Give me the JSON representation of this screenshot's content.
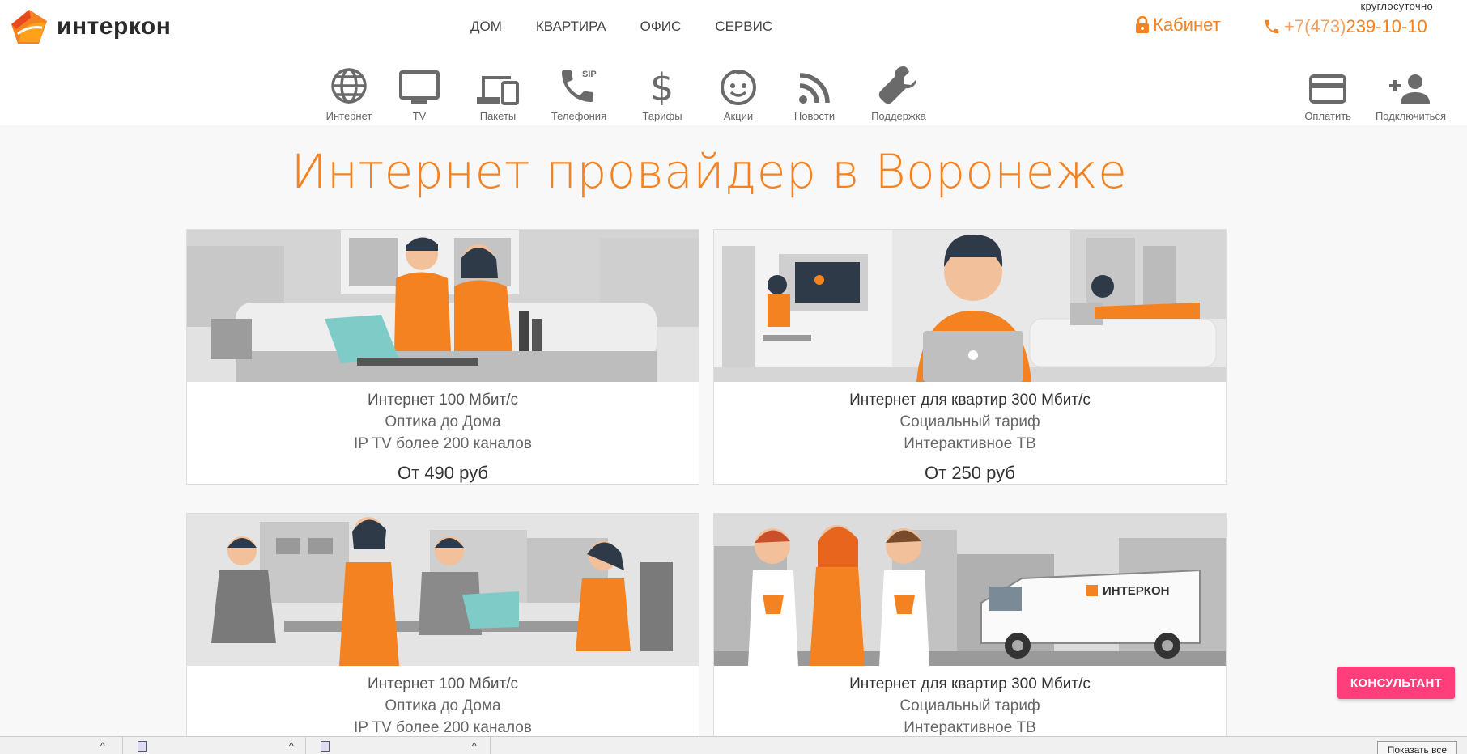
{
  "brand": {
    "name": "интеркон"
  },
  "topnav": [
    {
      "label": "ДОМ"
    },
    {
      "label": "КВАРТИРА"
    },
    {
      "label": "ОФИС"
    },
    {
      "label": "СЕРВИС"
    }
  ],
  "cabinet": {
    "label": "Кабинет"
  },
  "contact": {
    "note": "круглосуточно",
    "phone_code": "+7(473)",
    "phone_number": " 239-10-10"
  },
  "iconnav": [
    {
      "label": "Интернет",
      "icon": "globe-icon"
    },
    {
      "label": "TV",
      "icon": "tv-icon"
    },
    {
      "label": "Пакеты",
      "icon": "devices-icon"
    },
    {
      "label": "Телефония",
      "icon": "sip-phone-icon"
    },
    {
      "label": "Тарифы",
      "icon": "dollar-icon"
    },
    {
      "label": "Акции",
      "icon": "smiley-icon"
    },
    {
      "label": "Новости",
      "icon": "rss-icon"
    },
    {
      "label": "Поддержка",
      "icon": "wrench-icon"
    }
  ],
  "rightnav": [
    {
      "label": "Оплатить",
      "icon": "credit-card-icon"
    },
    {
      "label": "Подключиться",
      "icon": "add-user-icon"
    }
  ],
  "main": {
    "title": "Интернет провайдер в Воронеже",
    "cards": [
      {
        "lines": [
          "Интернет 100 Мбит/с",
          "Оптика до Дома",
          "IP TV более 200 каналов"
        ],
        "price": "От 490 руб"
      },
      {
        "lines": [
          "Интернет для квартир 300 Мбит/с",
          "Социальный тариф",
          "Интерактивное ТВ"
        ],
        "price": "От 250 руб"
      },
      {
        "lines": [
          "Интернет 100 Мбит/с",
          "Оптика до Дома",
          "IP TV более 200 каналов"
        ]
      },
      {
        "lines": [
          "Интернет для квартир 300 Мбит/с",
          "Социальный тариф",
          "Интерактивное ТВ"
        ]
      }
    ]
  },
  "consultant": {
    "label": "КОНСУЛЬТАНТ"
  },
  "van": {
    "brand": "ИНТЕРКОН"
  },
  "downloads": {
    "show_all": "Показать все"
  },
  "colors": {
    "accent": "#f58220",
    "consult": "#ff3e7b",
    "icon_gray": "#6a6a6a"
  }
}
